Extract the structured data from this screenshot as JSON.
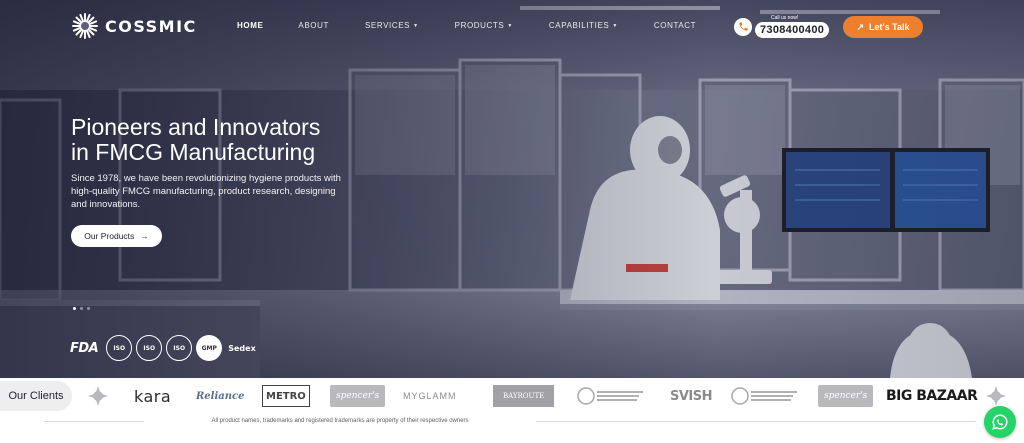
{
  "brand": {
    "name": "COSSMIC"
  },
  "nav": {
    "items": [
      {
        "label": "HOME",
        "active": true,
        "dropdown": false
      },
      {
        "label": "ABOUT",
        "active": false,
        "dropdown": false
      },
      {
        "label": "SERVICES",
        "active": false,
        "dropdown": true
      },
      {
        "label": "PRODUCTS",
        "active": false,
        "dropdown": true
      },
      {
        "label": "CAPABILITIES",
        "active": false,
        "dropdown": true
      },
      {
        "label": "CONTACT",
        "active": false,
        "dropdown": false
      }
    ],
    "call_label": "Call us now!",
    "phone": "7308400400",
    "cta_label": "Let's Talk"
  },
  "hero": {
    "headline_line1": "Pioneers and Innovators",
    "headline_line2": "in FMCG Manufacturing",
    "subtext": "Since 1978, we have been revolutionizing hygiene products with high-quality FMCG manufacturing, product research, designing and innovations.",
    "button_label": "Our Products",
    "slides": 3,
    "active_slide": 0
  },
  "certifications": [
    "FDA",
    "ISO",
    "ISO",
    "ISO",
    "GMP",
    "Sedex"
  ],
  "clients": {
    "label": "Our Clients",
    "logos": [
      "kara",
      "Reliance",
      "METRO",
      "spencer's",
      "MYGLAMM",
      "BAYROUTE",
      "SVISH",
      "spencer's",
      "BIG BAZAAR"
    ]
  },
  "footer": {
    "disclaimer": "All product names, trademarks and registered trademarks are property of their respective owners"
  },
  "colors": {
    "accent": "#ee7f2d",
    "whatsapp": "#25d366",
    "hero_overlay": "#2a2c42"
  }
}
